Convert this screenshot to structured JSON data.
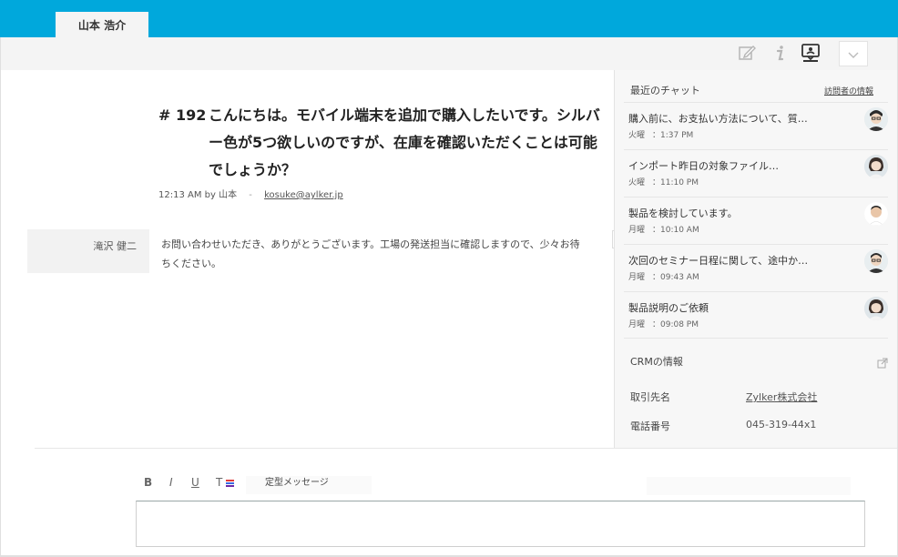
{
  "tab": {
    "label": "山本 浩介"
  },
  "toolbar": {
    "icons": [
      "edit-icon",
      "info-icon",
      "chat-icon",
      "chevron-down-icon"
    ]
  },
  "message": {
    "number": "# 192",
    "title": "こんにちは。モバイル端末を追加で購入したいです。シルバー色が5つ欲しいのですが、在庫を確認いただくことは可能でしょうか？",
    "time": "12:13 AM by 山本",
    "separator": "-",
    "email": "kosuke@aylker.jp"
  },
  "reply": {
    "name": "滝沢 健二",
    "text": "お問い合わせいただき、ありがとうございます。工場の発送担当に確認しますので、少々お待ちください。"
  },
  "collapse": {
    "label": "»"
  },
  "recent_chats": {
    "heading": "最近のチャット",
    "visitor_info_link": "訪問者の情報",
    "items": [
      {
        "title": "購入前に、お支払い方法について、質…",
        "day": "火曜",
        "time": "：1:37 PM"
      },
      {
        "title": "インポート昨日の対象ファイル…",
        "day": "火曜",
        "time": "：11:10 PM"
      },
      {
        "title": "製品を検討しています。",
        "day": "月曜",
        "time": "：10:10 AM"
      },
      {
        "title": "次回のセミナー日程に関して、途中か…",
        "day": "月曜",
        "time": "：09:43 AM"
      },
      {
        "title": "製品説明のご依頼",
        "day": "月曜",
        "time": "：09:08 PM"
      }
    ]
  },
  "crm": {
    "heading": "CRMの情報",
    "rows": [
      {
        "label": "取引先名",
        "value": "Zylker株式会社"
      },
      {
        "label": "電話番号",
        "value": "045-319-44x1"
      }
    ]
  },
  "editor": {
    "bold": "B",
    "italic": "I",
    "underline": "U",
    "text_color": "T",
    "canned_label": "定型メッセージ"
  }
}
